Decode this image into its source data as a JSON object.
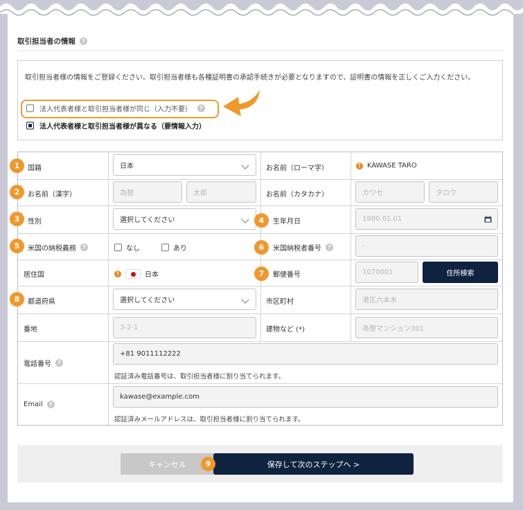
{
  "section": {
    "title": "取引担当者の情報"
  },
  "info": {
    "description": "取引担当者様の情報をご登録ください。取引担当者様も各種証明書の承認手続きが必要となりますので、証明書の情報を正しくご入力ください。",
    "option_same": "法人代表者様と取引担当者様が同じ（入力不要）",
    "option_different": "法人代表者様と取引担当者様が異なる（要情報入力）"
  },
  "badges": [
    "1",
    "2",
    "3",
    "4",
    "5",
    "6",
    "7",
    "8",
    "9"
  ],
  "form": {
    "nationality": {
      "label": "国籍",
      "value": "日本"
    },
    "name_romaji": {
      "label": "お名前（ローマ字）",
      "value": "KAWASE TARO"
    },
    "name_kanji": {
      "label": "お名前（漢字）",
      "last_placeholder": "為替",
      "first_placeholder": "太郎"
    },
    "name_kana": {
      "label": "お名前（カタカナ）",
      "last_placeholder": "カワセ",
      "first_placeholder": "タロウ"
    },
    "gender": {
      "label": "性別",
      "value": "選択してください"
    },
    "birthdate": {
      "label": "生年月日",
      "placeholder": "1980.01.01"
    },
    "us_tax": {
      "label": "米国の納税義務",
      "opt_no": "なし",
      "opt_yes": "あり"
    },
    "us_tax_id": {
      "label": "米国納税者番号",
      "placeholder": "-"
    },
    "residence": {
      "label": "居住国",
      "value": "日本"
    },
    "postal": {
      "label": "郵便番号",
      "placeholder": "1070001",
      "button": "住所検索"
    },
    "prefecture": {
      "label": "都道府県",
      "value": "選択してください"
    },
    "city": {
      "label": "市区町村",
      "placeholder": "港区六本木"
    },
    "street": {
      "label": "番地",
      "placeholder": "3-2-1"
    },
    "building": {
      "label": "建物など (*)",
      "placeholder": "為替マンション301"
    },
    "phone": {
      "label": "電話番号",
      "value": "+81 9011112222",
      "note": "認証済み電話番号は、取引担当者様に割り当てられます。"
    },
    "email": {
      "label": "Email",
      "value": "kawase@example.com",
      "note": "認証済みメールアドレスは、取引担当者様に割り当てられます。"
    }
  },
  "footer": {
    "cancel": "キャンセル",
    "save": "保存して次のステップへ >"
  },
  "colors": {
    "accent": "#f0982c",
    "navy": "#0f2340"
  }
}
